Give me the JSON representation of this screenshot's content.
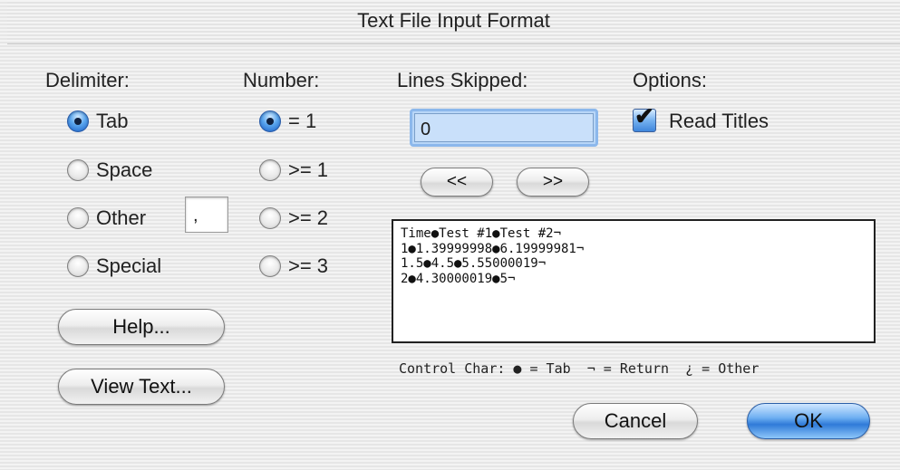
{
  "window": {
    "title": "Text File Input Format"
  },
  "delimiter": {
    "heading": "Delimiter:",
    "options": [
      {
        "label": "Tab",
        "selected": true
      },
      {
        "label": "Space",
        "selected": false
      },
      {
        "label": "Other",
        "selected": false
      },
      {
        "label": "Special",
        "selected": false
      }
    ],
    "other_value": ","
  },
  "number": {
    "heading": "Number:",
    "options": [
      {
        "label": "= 1",
        "selected": true
      },
      {
        "label": ">= 1",
        "selected": false
      },
      {
        "label": ">= 2",
        "selected": false
      },
      {
        "label": ">= 3",
        "selected": false
      }
    ]
  },
  "lines_skipped": {
    "heading": "Lines Skipped:",
    "value": "0",
    "prev_label": "<<",
    "next_label": ">>"
  },
  "options": {
    "heading": "Options:",
    "read_titles_label": "Read Titles",
    "read_titles_checked": true,
    "checkmark": "✔"
  },
  "preview": {
    "lines": [
      "Time●Test #1●Test #2¬",
      "1●1.39999998●6.19999981¬",
      "1.5●4.5●5.55000019¬",
      "2●4.30000019●5¬"
    ],
    "legend": "Control Char: ● = Tab  ¬ = Return  ¿ = Other"
  },
  "buttons": {
    "help": "Help...",
    "view_text": "View Text...",
    "cancel": "Cancel",
    "ok": "OK"
  },
  "colors": {
    "default_button": "#2f7ad8",
    "focus_ring": "#8cb8ec"
  }
}
